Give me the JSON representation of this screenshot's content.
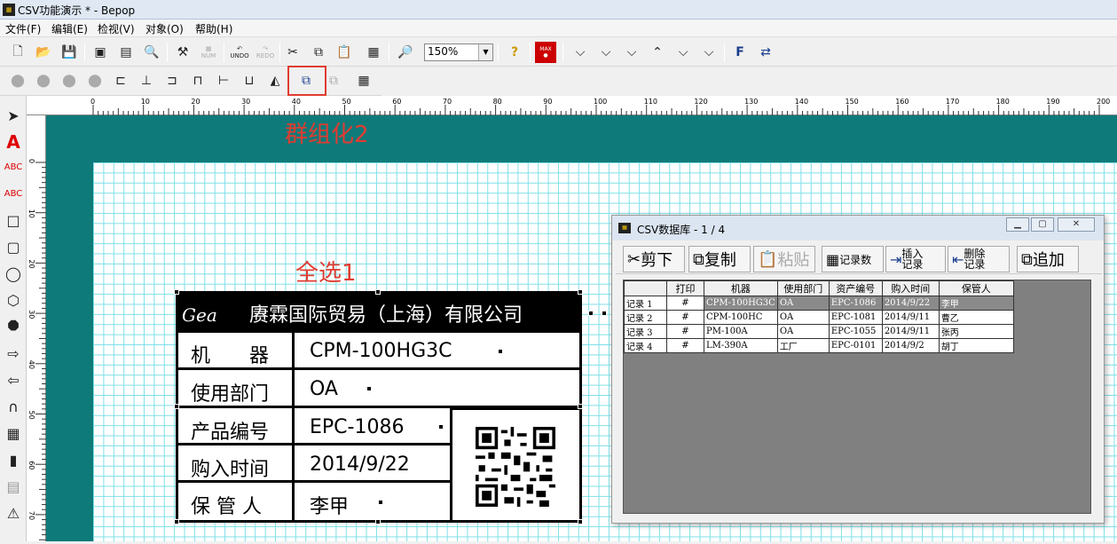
{
  "window": {
    "title": "CSV功能演示 * - Bepop"
  },
  "menu": [
    "文件(F)",
    "编辑(E)",
    "检视(V)",
    "对象(O)",
    "帮助(H)"
  ],
  "toolbar": {
    "zoom": "150%",
    "undo": "UNDO",
    "redo": "REDO",
    "num": "NUM",
    "max": "MAX"
  },
  "annotations": {
    "group": "群组化2",
    "select_all": "全选1"
  },
  "label": {
    "company": "赓霖国际贸易（上海）有限公司",
    "logo": "Gea",
    "rows": [
      {
        "label": "机　　器",
        "value": "CPM-100HG3C"
      },
      {
        "label": "使用部门",
        "value": "OA"
      },
      {
        "label": "产品编号",
        "value": "EPC-1086"
      },
      {
        "label": "购入时间",
        "value": "2014/9/22"
      },
      {
        "label": "保 管 人",
        "value": "李甲"
      }
    ]
  },
  "dialog": {
    "title": "CSV数据库 - 1 / 4",
    "buttons": {
      "cut": "剪下",
      "copy": "复制",
      "paste": "粘贴",
      "count": "记录数",
      "insert_top": "插入",
      "insert_bottom": "记录",
      "delete_top": "删除",
      "delete_bottom": "记录",
      "append": "追加"
    },
    "columns": [
      "",
      "打印",
      "机器",
      "使用部门",
      "资产编号",
      "购入时间",
      "保管人"
    ],
    "records": [
      [
        "记录 1",
        "#",
        "CPM-100HG3C",
        "OA",
        "EPC-1086",
        "2014/9/22",
        "李甲"
      ],
      [
        "记录 2",
        "#",
        "CPM-100HC",
        "OA",
        "EPC-1081",
        "2014/9/11",
        "曹乙"
      ],
      [
        "记录 3",
        "#",
        "PM-100A",
        "OA",
        "EPC-1055",
        "2014/9/11",
        "张丙"
      ],
      [
        "记录 4",
        "#",
        "LM-390A",
        "工厂",
        "EPC-0101",
        "2014/9/2",
        "胡丁"
      ]
    ]
  },
  "ruler": {
    "h_ticks": [
      "0",
      "10",
      "20",
      "30",
      "40",
      "50",
      "60",
      "70",
      "80",
      "90",
      "100",
      "110",
      "120",
      "130",
      "140",
      "150",
      "160",
      "170",
      "180",
      "190",
      "200"
    ],
    "v_ticks": [
      "0",
      "10",
      "20",
      "30",
      "40",
      "50",
      "60",
      "70"
    ]
  },
  "colors": {
    "canvas": "#0f7a7a",
    "accent": "#e03c31",
    "grid": "#7fe0e8"
  }
}
